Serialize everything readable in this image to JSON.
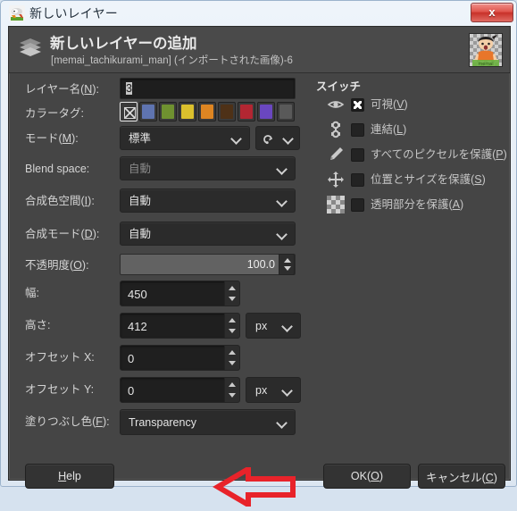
{
  "window": {
    "title": "新しいレイヤー",
    "title_icon": "gimp-layer-icon",
    "close_label": "x"
  },
  "header": {
    "icon": "layers-icon",
    "title": "新しいレイヤーの追加",
    "subtitle": "[memai_tachikurami_man] (インポートされた画像)-6",
    "thumbnail": "layer-thumbnail-preview"
  },
  "form": {
    "layer_name": {
      "label": "レイヤー名(N):",
      "mnemonic": "N",
      "value": "3",
      "selected": true
    },
    "color_tag": {
      "label": "カラータグ:",
      "selected_index": 0,
      "swatches": [
        {
          "name": "none",
          "color": "#3a3a3a"
        },
        {
          "name": "blue",
          "color": "#5f74b0"
        },
        {
          "name": "green",
          "color": "#6f9130"
        },
        {
          "name": "yellow",
          "color": "#dbc02d"
        },
        {
          "name": "orange",
          "color": "#dd8522"
        },
        {
          "name": "brown",
          "color": "#4e3117"
        },
        {
          "name": "red",
          "color": "#b22632"
        },
        {
          "name": "violet",
          "color": "#6a47c0"
        },
        {
          "name": "gray",
          "color": "#595959"
        }
      ]
    },
    "mode": {
      "label": "モード(M):",
      "mnemonic": "M",
      "value": "標準",
      "reset_icon": "undo-icon"
    },
    "blend_space": {
      "label": "Blend space:",
      "value": "自動",
      "disabled": true
    },
    "composite_space": {
      "label": "合成色空間(I):",
      "mnemonic": "I",
      "value": "自動"
    },
    "composite_mode": {
      "label": "合成モード(D):",
      "mnemonic": "D",
      "value": "自動"
    },
    "opacity": {
      "label": "不透明度(O):",
      "mnemonic": "O",
      "value": "100.0"
    },
    "width": {
      "label": "幅:",
      "value": "450"
    },
    "height": {
      "label": "高さ:",
      "value": "412",
      "unit": "px"
    },
    "offset_x": {
      "label": "オフセット X:",
      "value": "0"
    },
    "offset_y": {
      "label": "オフセット Y:",
      "value": "0",
      "unit": "px"
    },
    "fill_color": {
      "label": "塗りつぶし色(F):",
      "mnemonic": "F",
      "value": "Transparency"
    }
  },
  "switches": {
    "title": "スイッチ",
    "items": [
      {
        "icon": "eye-icon",
        "label": "可視(V)",
        "checked": true
      },
      {
        "icon": "chain-link-icon",
        "label": "連結(L)",
        "checked": false
      },
      {
        "icon": "paintbrush-icon",
        "label": "すべてのピクセルを保護(P)",
        "checked": false
      },
      {
        "icon": "move-arrows-icon",
        "label": "位置とサイズを保護(S)",
        "checked": false
      },
      {
        "icon": "checkerboard-icon",
        "label": "透明部分を保護(A)",
        "checked": false
      }
    ]
  },
  "buttons": {
    "help": "Help",
    "ok": "OK(O)",
    "cancel": "キャンセル(C)"
  },
  "annotation": {
    "shape": "left-pointing-arrow",
    "color": "#e8232a",
    "points_at": "塗りつぶし色(F) dropdown"
  },
  "colors": {
    "dialog_bg": "#454545",
    "header_bg": "#4a4a4a",
    "entry_bg": "#1e1e1e",
    "combo_bg": "#2b2b2b",
    "text": "#d4d4d4",
    "titlebar_text": "#22303d",
    "close_btn": "#c8312a"
  }
}
